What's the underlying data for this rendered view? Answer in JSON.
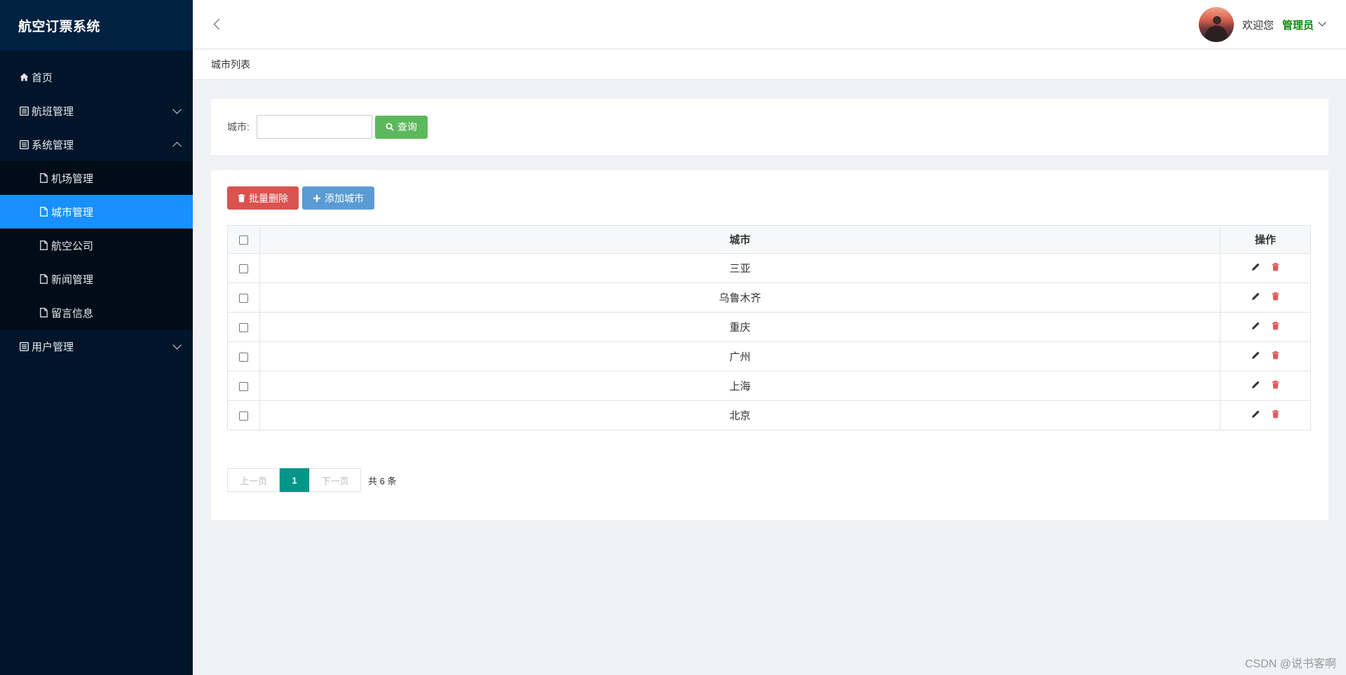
{
  "sidebar": {
    "brand": "航空订票系统",
    "items": [
      {
        "label": "首页",
        "icon": "home-icon"
      },
      {
        "label": "航班管理",
        "icon": "list-icon",
        "expanded": false
      },
      {
        "label": "系统管理",
        "icon": "list-icon",
        "expanded": true,
        "children": [
          {
            "label": "机场管理",
            "icon": "file-icon"
          },
          {
            "label": "城市管理",
            "icon": "file-icon",
            "active": true
          },
          {
            "label": "航空公司",
            "icon": "file-icon"
          },
          {
            "label": "新闻管理",
            "icon": "file-icon"
          },
          {
            "label": "留言信息",
            "icon": "file-icon"
          }
        ]
      },
      {
        "label": "用户管理",
        "icon": "list-icon",
        "expanded": false
      }
    ]
  },
  "header": {
    "welcome": "欢迎您",
    "role": "管理员"
  },
  "breadcrumb": "城市列表",
  "search": {
    "label": "城市:",
    "value": "",
    "button": "查询"
  },
  "toolbar": {
    "batch_delete": "批量删除",
    "add": "添加城市"
  },
  "table": {
    "columns": [
      "城市",
      "操作"
    ],
    "rows": [
      "三亚",
      "乌鲁木齐",
      "重庆",
      "广州",
      "上海",
      "北京"
    ]
  },
  "pagination": {
    "prev": "上一页",
    "current": "1",
    "next": "下一页",
    "total": "共 6 条"
  },
  "watermark": "CSDN @说书客啊",
  "colors": {
    "sidebar_bg": "#001529",
    "brand_bg": "#002140",
    "active_menu": "#1890ff",
    "role_text": "#0a8a0a",
    "search_btn": "#5cb85c",
    "delete_btn": "#d9534f",
    "add_btn": "#5b9bd5",
    "page_current": "#009688"
  }
}
